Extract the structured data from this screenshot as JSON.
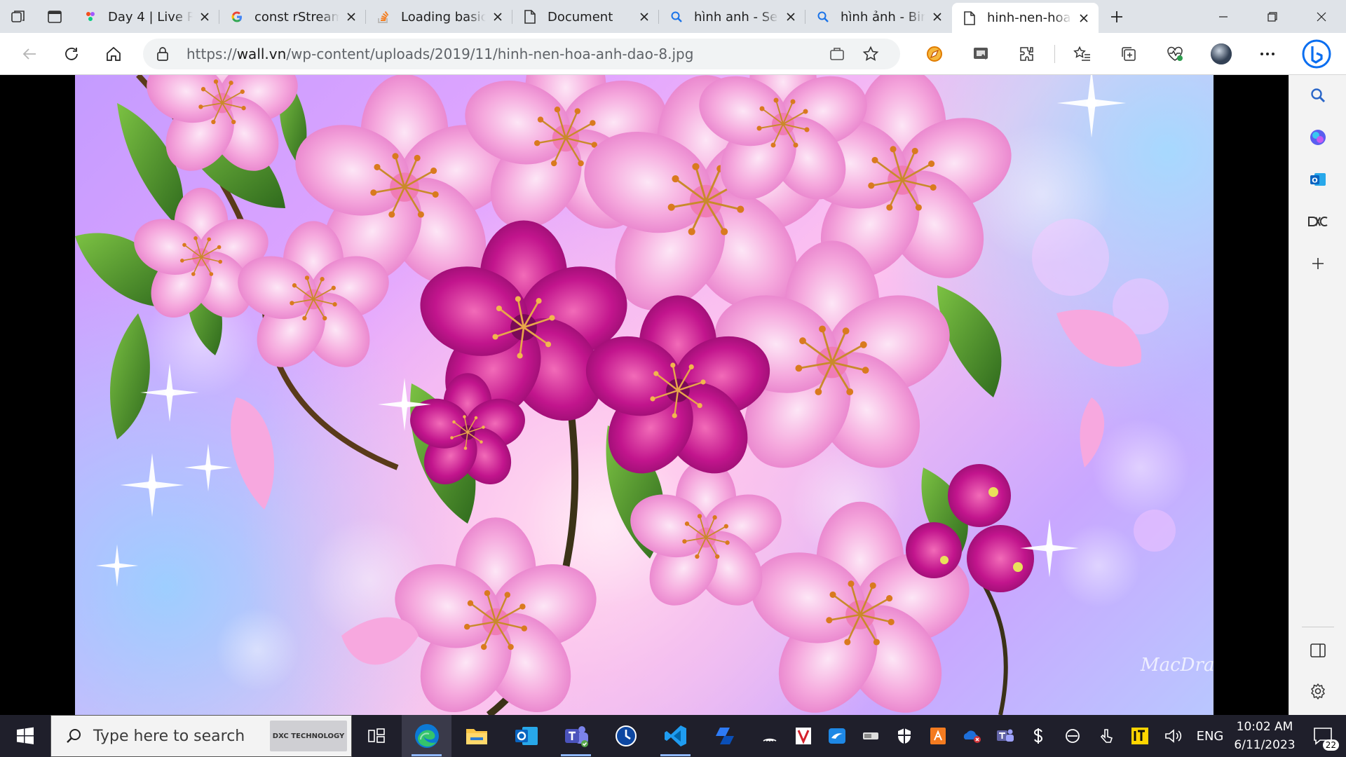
{
  "browser": {
    "tabs": [
      {
        "title": "Day 4 | Live Re",
        "favicon": "figma-icon"
      },
      {
        "title": "const rStream",
        "favicon": "google-icon"
      },
      {
        "title": "Loading basic",
        "favicon": "stackoverflow-icon"
      },
      {
        "title": "Document",
        "favicon": "document-icon"
      },
      {
        "title": "hình anh - Se",
        "favicon": "bing-search-icon"
      },
      {
        "title": "hình ảnh - Bin",
        "favicon": "bing-search-icon"
      },
      {
        "title": "hinh-nen-hoa",
        "favicon": "document-icon",
        "active": true
      }
    ],
    "url_prefix": "https://",
    "url_domain": "wall.vn",
    "url_path": "/wp-content/uploads/2019/11/hinh-nen-hoa-anh-dao-8.jpg"
  },
  "content": {
    "image_description_alt": "hinh-nen-hoa-anh-dao-8.jpg",
    "watermark": "MacDragon",
    "colors": {
      "sky": "#c49bff",
      "blossom_light": "#ffb7e4",
      "blossom_deep": "#c2158d",
      "leaf": "#3f7a25"
    }
  },
  "taskbar": {
    "search_placeholder": "Type here to search",
    "search_badge": "DXC TECHNOLOGY",
    "lang": "ENG",
    "time": "10:02 AM",
    "date": "6/11/2023",
    "notifications": "22"
  }
}
